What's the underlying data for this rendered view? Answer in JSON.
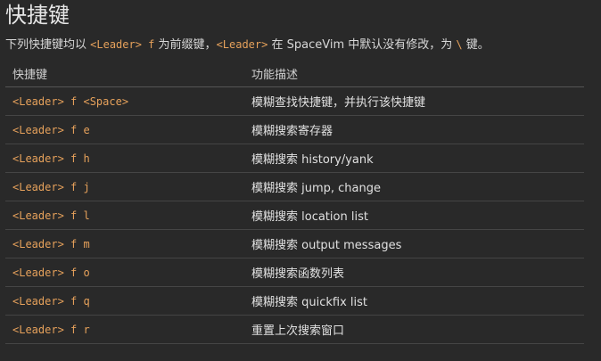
{
  "title": "快捷键",
  "intro": {
    "text1": "下列快捷键均以",
    "code1": "<Leader> f",
    "text2": "为前缀键，",
    "code2": "<Leader>",
    "text3": "在 SpaceVim 中默认没有修改，为",
    "code3": "\\",
    "text4": "键。"
  },
  "table": {
    "headers": [
      "快捷键",
      "功能描述"
    ],
    "rows": [
      {
        "key": "<Leader> f <Space>",
        "desc": "模糊查找快捷键，并执行该快捷键"
      },
      {
        "key": "<Leader> f e",
        "desc": "模糊搜索寄存器"
      },
      {
        "key": "<Leader> f h",
        "desc": "模糊搜索 history/yank"
      },
      {
        "key": "<Leader> f j",
        "desc": "模糊搜索 jump, change"
      },
      {
        "key": "<Leader> f l",
        "desc": "模糊搜索 location list"
      },
      {
        "key": "<Leader> f m",
        "desc": "模糊搜索 output messages"
      },
      {
        "key": "<Leader> f o",
        "desc": "模糊搜索函数列表"
      },
      {
        "key": "<Leader> f q",
        "desc": "模糊搜索 quickfix list"
      },
      {
        "key": "<Leader> f r",
        "desc": "重置上次搜索窗口"
      }
    ]
  },
  "colors": {
    "background": "#292929",
    "code": "#e6a15b",
    "text": "#d8d8d8"
  }
}
